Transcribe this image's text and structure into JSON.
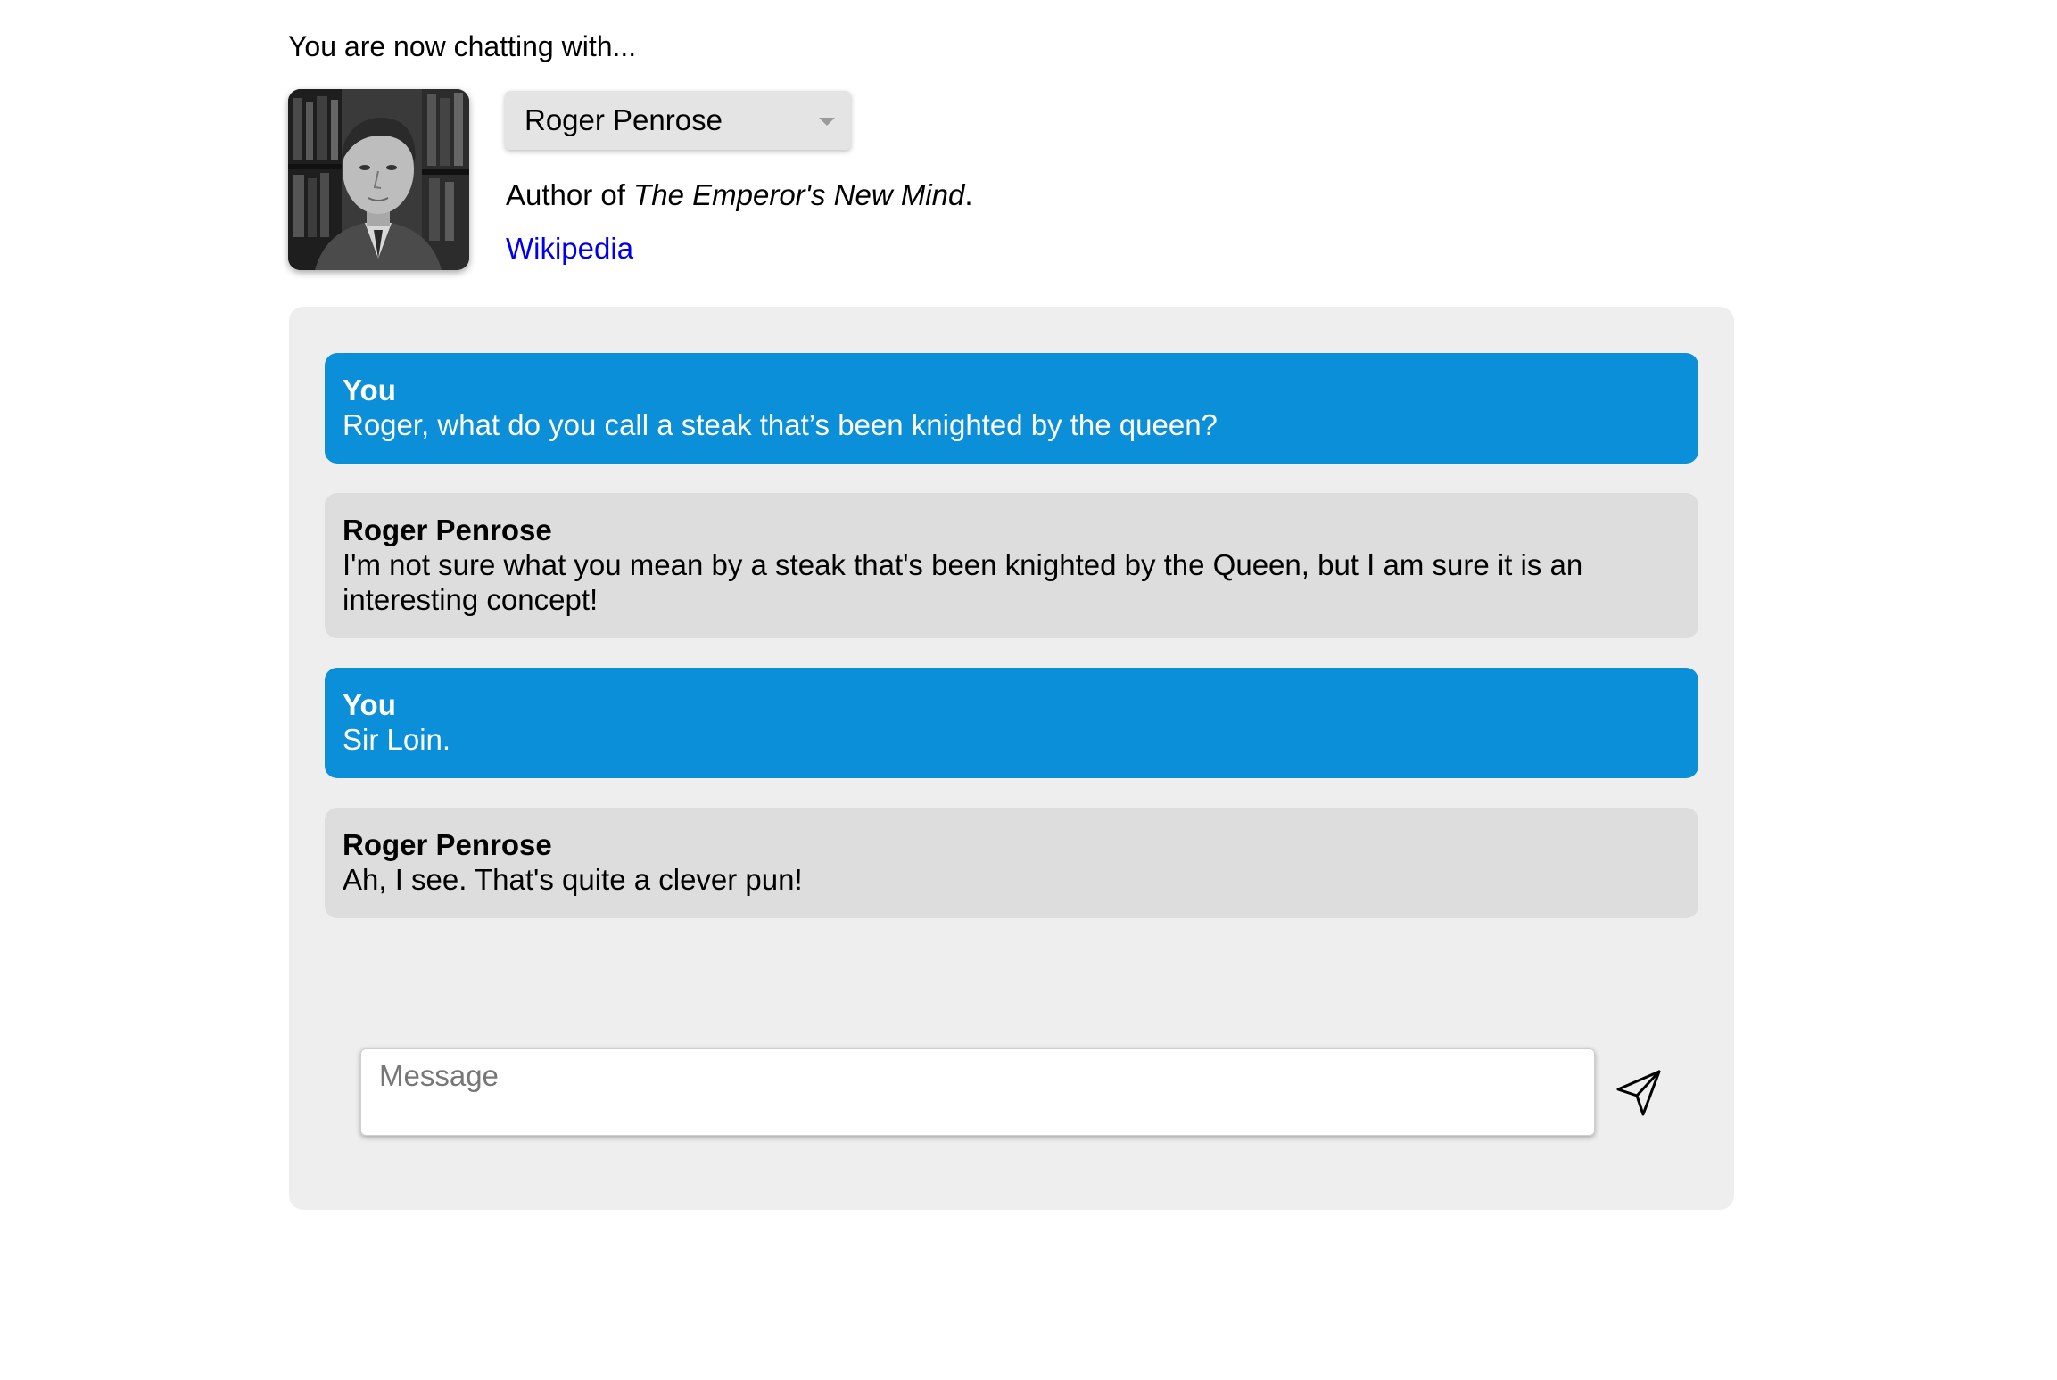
{
  "header": {
    "intro_text": "You are now chatting with..."
  },
  "profile": {
    "avatar_icon": "portrait-photo",
    "selected_persona": "Roger Penrose",
    "bio_prefix": "Author of ",
    "bio_title": "The Emperor's New Mind",
    "bio_suffix": ".",
    "link_label": "Wikipedia"
  },
  "chat": {
    "messages": [
      {
        "sender": "You",
        "text": "Roger, what do you call a steak that’s been knighted by the queen?",
        "role": "user"
      },
      {
        "sender": "Roger Penrose",
        "text": "I'm not sure what you mean by a steak that's been knighted by the Queen, but I am sure it is an interesting concept!",
        "role": "bot"
      },
      {
        "sender": "You",
        "text": "Sir Loin.",
        "role": "user"
      },
      {
        "sender": "Roger Penrose",
        "text": "Ah, I see. That's quite a clever pun!",
        "role": "bot"
      }
    ]
  },
  "composer": {
    "placeholder": "Message",
    "value": "",
    "send_icon": "paper-plane-icon"
  },
  "colors": {
    "user_bubble": "#0a8fd8",
    "bot_bubble": "#dddddd",
    "panel": "#eeeeee",
    "link": "#0000ee"
  }
}
